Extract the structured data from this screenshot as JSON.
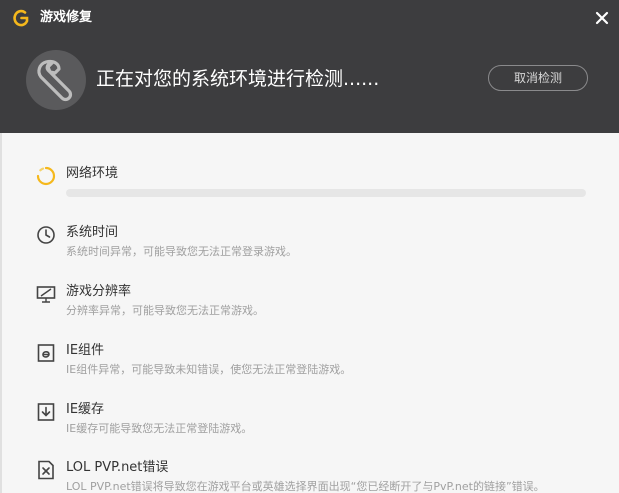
{
  "window": {
    "title": "游戏修复",
    "logo_icon": "game-logo-icon",
    "close_icon": "close-icon"
  },
  "scan": {
    "title": "正在对您的系统环境进行检测......",
    "icon": "wrench-icon",
    "cancel_label": "取消检测"
  },
  "colors": {
    "header_bg": "#3d3d3f",
    "accent": "#f5b81c",
    "body_bg": "#f6f6f6"
  },
  "checks": [
    {
      "title": "网络环境",
      "desc": "",
      "icon": "loading-spinner-icon",
      "status": "checking",
      "progress": 0
    },
    {
      "title": "系统时间",
      "desc": "系统时间异常，可能导致您无法正常登录游戏。",
      "icon": "clock-icon"
    },
    {
      "title": "游戏分辨率",
      "desc": "分辨率异常，可能导致您无法正常游戏。",
      "icon": "monitor-icon"
    },
    {
      "title": "IE组件",
      "desc": "IE组件异常，可能导致未知错误，使您无法正常登陆游戏。",
      "icon": "ie-icon"
    },
    {
      "title": "IE缓存",
      "desc": "IE缓存可能导致您无法正常登陆游戏。",
      "icon": "download-cache-icon"
    },
    {
      "title": "LOL PVP.net错误",
      "desc": "LOL PVP.net错误将导致您在游戏平台或英雄选择界面出现“您已经断开了与PvP.net的链接”错误。",
      "icon": "error-file-icon"
    }
  ]
}
